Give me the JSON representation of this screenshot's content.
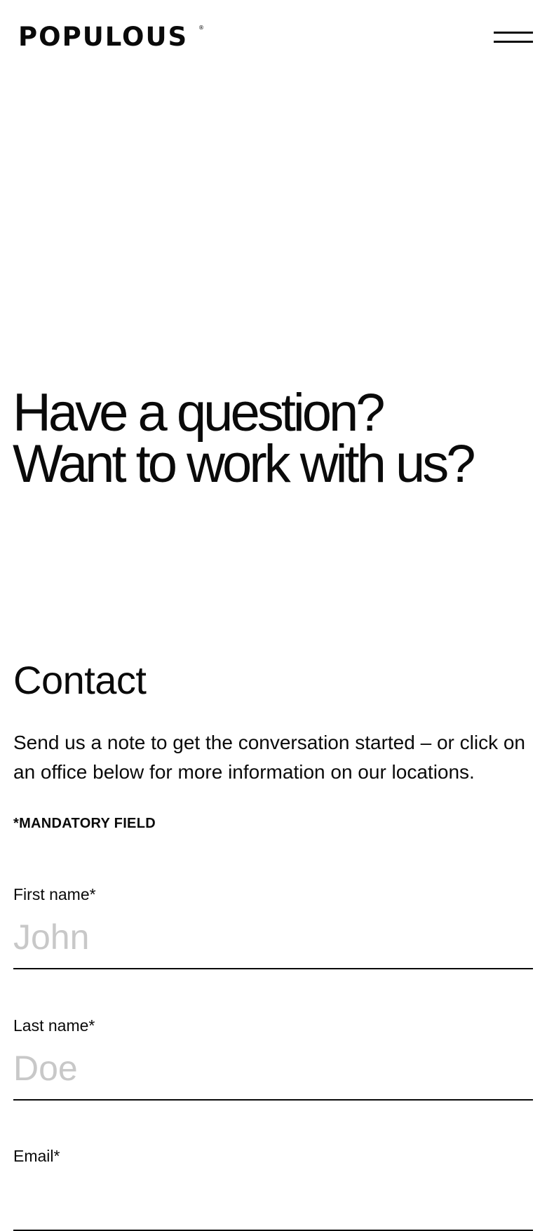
{
  "header": {
    "logo_text": "POPULOUS",
    "logo_mark": "®",
    "menu_icon": "hamburger-menu-icon"
  },
  "hero": {
    "line1": "Have a question?",
    "line2": "Want to work with us?"
  },
  "contact": {
    "title": "Contact",
    "intro": "Send us a note to get the conversation started – or click on an office below for more information on our locations.",
    "mandatory_note": "*MANDATORY FIELD"
  },
  "form": {
    "first_name": {
      "label": "First name*",
      "placeholder": "John",
      "value": ""
    },
    "last_name": {
      "label": "Last name*",
      "placeholder": "Doe",
      "value": ""
    },
    "email": {
      "label": "Email*",
      "placeholder": "",
      "value": ""
    }
  }
}
